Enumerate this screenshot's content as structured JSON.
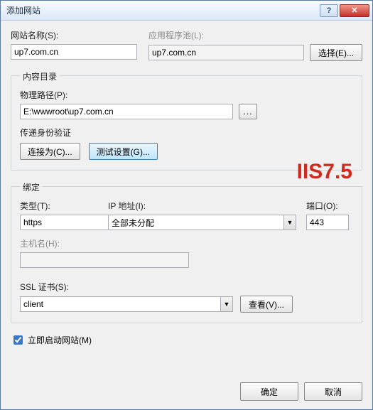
{
  "window": {
    "title": "添加网站"
  },
  "site_name": {
    "label": "网站名称(S):",
    "value": "up7.com.cn"
  },
  "app_pool": {
    "label": "应用程序池(L):",
    "value": "up7.com.cn",
    "select_btn": "选择(E)..."
  },
  "content_dir": {
    "legend": "内容目录",
    "path_label": "物理路径(P):",
    "path_value": "E:\\wwwroot\\up7.com.cn",
    "auth_label": "传递身份验证",
    "connect_as_btn": "连接为(C)...",
    "test_btn": "测试设置(G)..."
  },
  "watermark": "IIS7.5",
  "binding": {
    "legend": "绑定",
    "type_label": "类型(T):",
    "type_value": "https",
    "ip_label": "IP 地址(I):",
    "ip_value": "全部未分配",
    "port_label": "端口(O):",
    "port_value": "443",
    "host_label": "主机名(H):",
    "host_value": "",
    "ssl_label": "SSL 证书(S):",
    "ssl_value": "client",
    "view_btn": "查看(V)..."
  },
  "autostart": {
    "label": "立即启动网站(M)",
    "checked": true
  },
  "buttons": {
    "ok": "确定",
    "cancel": "取消"
  }
}
